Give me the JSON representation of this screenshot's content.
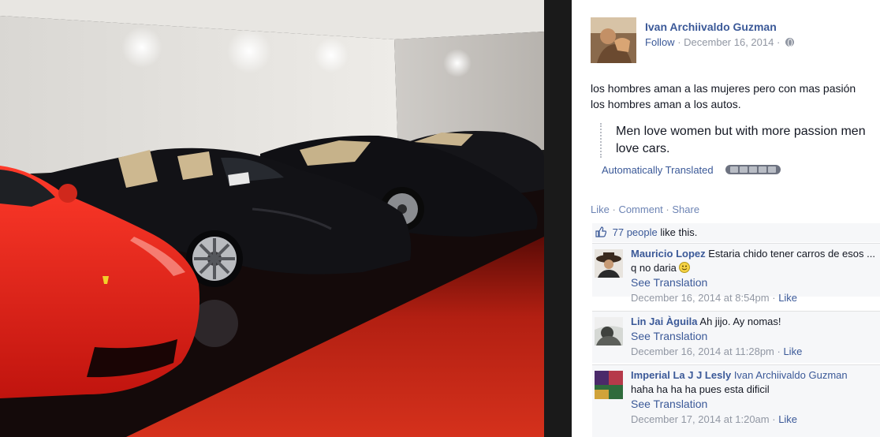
{
  "post": {
    "author": "Ivan Archiivaldo Guzman",
    "follow": "Follow",
    "date": "December 16, 2014",
    "text_line1": "los hombres aman a las mujeres pero con mas pasión",
    "text_line2": "los hombres aman a los autos.",
    "translation": "Men love women but with more passion men love cars.",
    "auto_translated": "Automatically Translated"
  },
  "actions": {
    "like": "Like",
    "comment": "Comment",
    "share": "Share"
  },
  "likes": {
    "count": "77 people",
    "suffix": "like this."
  },
  "comments": [
    {
      "name": "Mauricio Lopez",
      "text": "Estaria chido tener carros de esos ... q no daria",
      "see_translation": "See Translation",
      "time": "December 16, 2014 at 8:54pm",
      "like": "Like"
    },
    {
      "name": "Lin Jai Àguila",
      "text": "Ah jijo. Ay nomas!",
      "see_translation": "See Translation",
      "time": "December 16, 2014 at 11:28pm",
      "like": "Like"
    },
    {
      "name": "Imperial La J J Lesly",
      "tag": "Ivan Archiivaldo Guzman",
      "text": "haha ha ha ha pues esta dificil",
      "see_translation": "See Translation",
      "time": "December 17, 2014 at 1:20am",
      "like": "Like"
    }
  ],
  "colors": {
    "link_blue": "#3b5998",
    "meta_gray": "#9197a3",
    "panel_bg": "#ffffff",
    "comment_bg": "#f6f7f9",
    "car_red": "#e4201a",
    "car_black": "#121216",
    "floor_red": "#c42314"
  },
  "icons": [
    "globe-icon",
    "thumbs-up-icon",
    "smiley-icon",
    "bing-translator-logo"
  ]
}
